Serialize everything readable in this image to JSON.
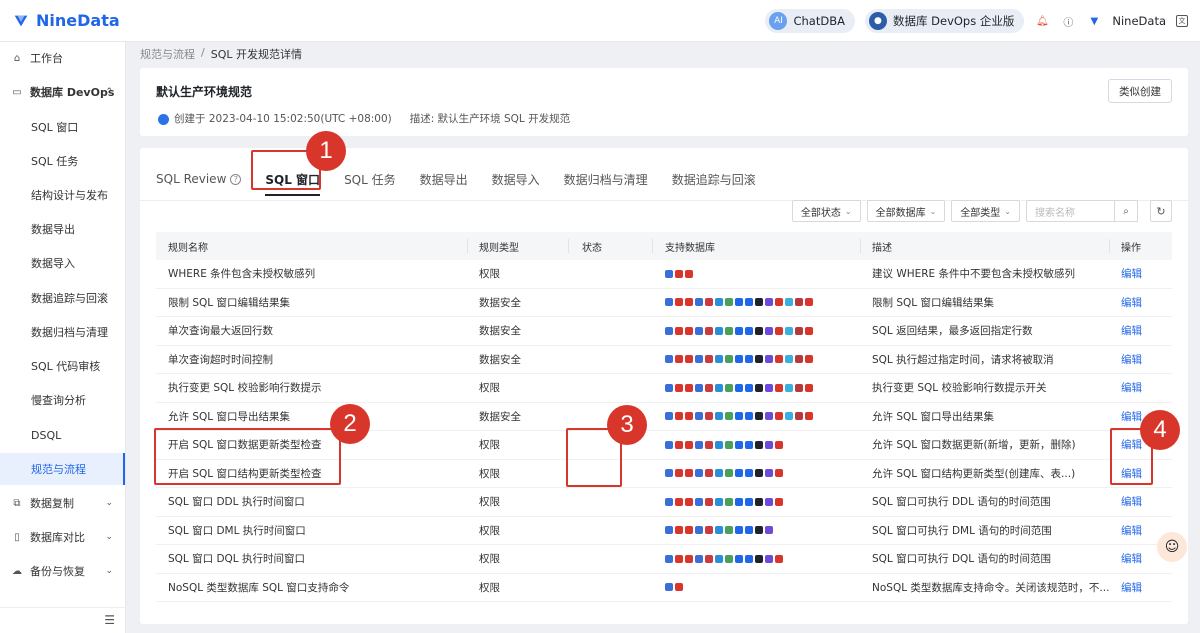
{
  "app": {
    "logo_text": "NineData"
  },
  "topbar": {
    "chatdba": "ChatDBA",
    "edition": "数据库 DevOps 企业版",
    "user": "NineData"
  },
  "sidebar": {
    "items": [
      {
        "label": "工作台",
        "icon": "home-icon"
      },
      {
        "label": "数据库 DevOps",
        "icon": "monitor-icon"
      },
      {
        "label": "SQL 窗口"
      },
      {
        "label": "SQL 任务"
      },
      {
        "label": "结构设计与发布"
      },
      {
        "label": "数据导出"
      },
      {
        "label": "数据导入"
      },
      {
        "label": "数据追踪与回滚"
      },
      {
        "label": "数据归档与清理"
      },
      {
        "label": "SQL 代码审核"
      },
      {
        "label": "慢查询分析"
      },
      {
        "label": "DSQL"
      },
      {
        "label": "规范与流程"
      },
      {
        "label": "数据复制",
        "icon": "copy-icon"
      },
      {
        "label": "数据库对比",
        "icon": "compare-icon"
      },
      {
        "label": "备份与恢复",
        "icon": "backup-icon"
      }
    ]
  },
  "breadcrumb": {
    "parent": "规范与流程",
    "sep": "/",
    "current": "SQL 开发规范详情"
  },
  "spec": {
    "title": "默认生产环境规范",
    "created": "创建于 2023-04-10 15:02:50(UTC +08:00)",
    "desc": "描述:  默认生产环境 SQL 开发规范",
    "clone_button": "类似创建"
  },
  "tabs": [
    {
      "label": "SQL Review"
    },
    {
      "label": "SQL 窗口"
    },
    {
      "label": "SQL 任务"
    },
    {
      "label": "数据导出"
    },
    {
      "label": "数据导入"
    },
    {
      "label": "数据归档与清理"
    },
    {
      "label": "数据追踪与回滚"
    }
  ],
  "filters": {
    "status": "全部状态",
    "database": "全部数据库",
    "type": "全部类型",
    "search_placeholder": "搜索名称"
  },
  "table": {
    "headers": [
      "规则名称",
      "规则类型",
      "状态",
      "支持数据库",
      "描述",
      "操作"
    ],
    "rows": [
      {
        "name": "WHERE 条件包含未授权敏感列",
        "type": "权限",
        "on": true,
        "dbs": 3,
        "desc": "建议 WHERE 条件中不要包含未授权敏感列",
        "action": "编辑"
      },
      {
        "name": "限制 SQL 窗口编辑结果集",
        "type": "数据安全",
        "on": false,
        "dbs": 15,
        "desc": "限制 SQL 窗口编辑结果集",
        "action": "编辑"
      },
      {
        "name": "单次查询最大返回行数",
        "type": "数据安全",
        "on": true,
        "dbs": 15,
        "desc": "SQL 返回结果，最多返回指定行数",
        "action": "编辑"
      },
      {
        "name": "单次查询超时时间控制",
        "type": "数据安全",
        "on": true,
        "dbs": 15,
        "desc": "SQL 执行超过指定时间，请求将被取消",
        "action": "编辑"
      },
      {
        "name": "执行变更 SQL 校验影响行数提示",
        "type": "权限",
        "on": true,
        "dbs": 15,
        "desc": "执行变更 SQL 校验影响行数提示开关",
        "action": "编辑"
      },
      {
        "name": "允许 SQL 窗口导出结果集",
        "type": "数据安全",
        "on": false,
        "dbs": 15,
        "desc": "允许 SQL 窗口导出结果集",
        "action": "编辑"
      },
      {
        "name": "开启 SQL 窗口数据更新类型检查",
        "type": "权限",
        "on": true,
        "dbs": 12,
        "desc": "允许 SQL 窗口数据更新(新增，更新，删除)",
        "action": "编辑"
      },
      {
        "name": "开启 SQL 窗口结构更新类型检查",
        "type": "权限",
        "on": true,
        "dbs": 12,
        "desc": "允许 SQL 窗口结构更新类型(创建库、表...)",
        "action": "编辑"
      },
      {
        "name": "SQL 窗口 DDL 执行时间窗口",
        "type": "权限",
        "on": true,
        "dbs": 12,
        "desc": "SQL 窗口可执行 DDL 语句的时间范围",
        "action": "编辑"
      },
      {
        "name": "SQL 窗口 DML 执行时间窗口",
        "type": "权限",
        "on": true,
        "dbs": 11,
        "desc": "SQL 窗口可执行 DML 语句的时间范围",
        "action": "编辑"
      },
      {
        "name": "SQL 窗口 DQL 执行时间窗口",
        "type": "权限",
        "on": true,
        "dbs": 12,
        "desc": "SQL 窗口可执行 DQL 语句的时间范围",
        "action": "编辑"
      },
      {
        "name": "NoSQL 类型数据库 SQL 窗口支持命令",
        "type": "权限",
        "on": true,
        "dbs": 2,
        "desc": "NoSQL 类型数据库支持命令。关闭该规范时，不...",
        "action": "编辑"
      }
    ]
  },
  "annotations": [
    "1",
    "2",
    "3",
    "4"
  ],
  "colors": {
    "accent": "#2066e8",
    "annotation": "#d9362b"
  }
}
